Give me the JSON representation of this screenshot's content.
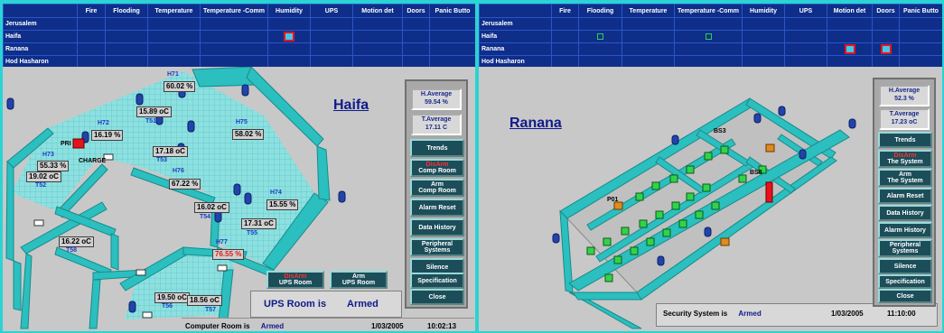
{
  "grid": {
    "columns": [
      "",
      "Fire",
      "Flooding",
      "Temperature",
      "Temperature -Comm",
      "Humidity",
      "UPS",
      "Motion det",
      "Doors",
      "Panic Butto"
    ],
    "columns_right": [
      "",
      "Fire",
      "Flooding",
      "Temperature",
      "Temperature -Comm",
      "Humidity",
      "UPS",
      "Motion det",
      "Doors",
      "Panic Butto"
    ],
    "rows": [
      "Jerusalem",
      "Haifa",
      "Ranana",
      "Hod Hasharon"
    ]
  },
  "haifa": {
    "title": "Haifa",
    "h_average_label": "H.Average",
    "h_average_value": "59.54",
    "h_unit": "%",
    "t_average_label": "T.Average",
    "t_average_value": "17.11",
    "t_unit": "C",
    "buttons": {
      "trends": "Trends",
      "disarm_top": "DisArm",
      "disarm_bottom": "Comp Room",
      "arm_top": "Arm",
      "arm_bottom": "Comp Room",
      "alarm_reset": "Alarm Reset",
      "data_history": "Data History",
      "peripheral_top": "Peripheral",
      "peripheral_bottom": "Systems",
      "silence": "Silence",
      "specification": "Specification",
      "close": "Close",
      "ups_disarm_top": "DisArm",
      "ups_disarm_bottom": "UPS Room",
      "ups_arm_top": "Arm",
      "ups_arm_bottom": "UPS Room"
    },
    "ups_status_label": "UPS Room is",
    "ups_status_value": "Armed",
    "footer_label": "Computer Room is",
    "footer_value": "Armed",
    "footer_date": "1/03/2005",
    "footer_time": "10:02:13",
    "sensors": {
      "h71": "60.02 %",
      "h72": "16.19 %",
      "h73": "55.33 %",
      "h74": "15.55 %",
      "h75": "58.02 %",
      "h76": "67.22 %",
      "h77": "76.55 %",
      "t51": "15.89 oC",
      "t52": "19.02 oC",
      "t53": "17.18 oC",
      "t54": "16.02 oC",
      "t55": "17.31 oC",
      "t56": "19.50 oC",
      "t57": "18.56 oC",
      "t58": "16.22 oC"
    },
    "tags": {
      "h71": "H71",
      "h72": "H72",
      "h73": "H73",
      "h74": "H74",
      "h75": "H75",
      "h76": "H76",
      "h77": "H77",
      "t51": "T51",
      "t52": "T52",
      "t53": "T53",
      "t54": "T54",
      "t55": "T55",
      "t56": "T56",
      "t57": "T57",
      "t58": "T58",
      "pr": "PRI",
      "charge": "CHARGE"
    }
  },
  "ranana": {
    "title": "Ranana",
    "h_average_label": "H.Average",
    "h_average_value": "52.3",
    "h_unit": "%",
    "t_average_label": "T.Average",
    "t_average_value": "17.23",
    "t_unit": "oC",
    "buttons": {
      "trends": "Trends",
      "disarm_top": "DisArm",
      "disarm_bottom": "The System",
      "arm_top": "Arm",
      "arm_bottom": "The System",
      "alarm_reset": "Alarm Reset",
      "data_history": "Data History",
      "alarm_history": "Alarm History",
      "peripheral_top": "Peripheral",
      "peripheral_bottom": "Systems",
      "silence": "Silence",
      "specification": "Specification",
      "close": "Close"
    },
    "footer_label": "Security System is",
    "footer_value": "Armed",
    "footer_date": "1/03/2005",
    "footer_time": "11:10:00",
    "tags": {
      "bs3": "BS3",
      "bs8": "BS8",
      "p01": "P01"
    }
  },
  "colors": {
    "grid_bg": "#0f2e8a",
    "wall": "#2bbfbf",
    "floor": "#8ee0e0",
    "alarm_red": "#e8121b",
    "button_bg": "#1c4e5a",
    "frame": "#2ad4d4"
  }
}
